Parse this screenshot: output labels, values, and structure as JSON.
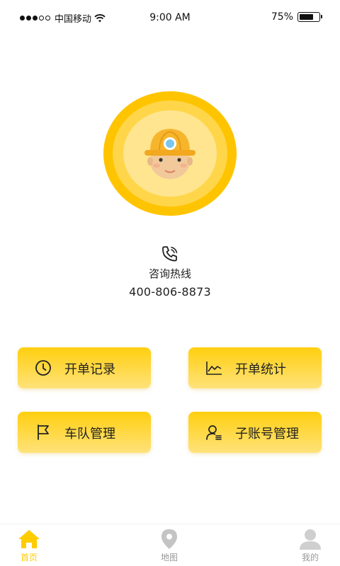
{
  "status_bar": {
    "carrier": "中国移动",
    "time": "9:00 AM",
    "battery_percent": "75%",
    "battery_level": 0.75,
    "signal_bars_filled": 3,
    "signal_bars_total": 5
  },
  "avatar": {
    "description_icon": "miner-helmet-avatar"
  },
  "hotline": {
    "title": "咨询热线",
    "number": "400-806-8873",
    "icon": "phone-icon"
  },
  "actions": [
    {
      "label": "开单记录",
      "icon": "clock-icon"
    },
    {
      "label": "开单统计",
      "icon": "line-chart-icon"
    },
    {
      "label": "车队管理",
      "icon": "flag-icon"
    },
    {
      "label": "子账号管理",
      "icon": "user-list-icon"
    }
  ],
  "tabs": [
    {
      "label": "首页",
      "icon": "home-icon",
      "active": true
    },
    {
      "label": "地图",
      "icon": "map-pin-icon",
      "active": false
    },
    {
      "label": "我的",
      "icon": "user-icon",
      "active": false
    }
  ],
  "colors": {
    "accent": "#ffcc00",
    "tab_active": "#ffcc00",
    "tab_inactive": "#999999"
  }
}
